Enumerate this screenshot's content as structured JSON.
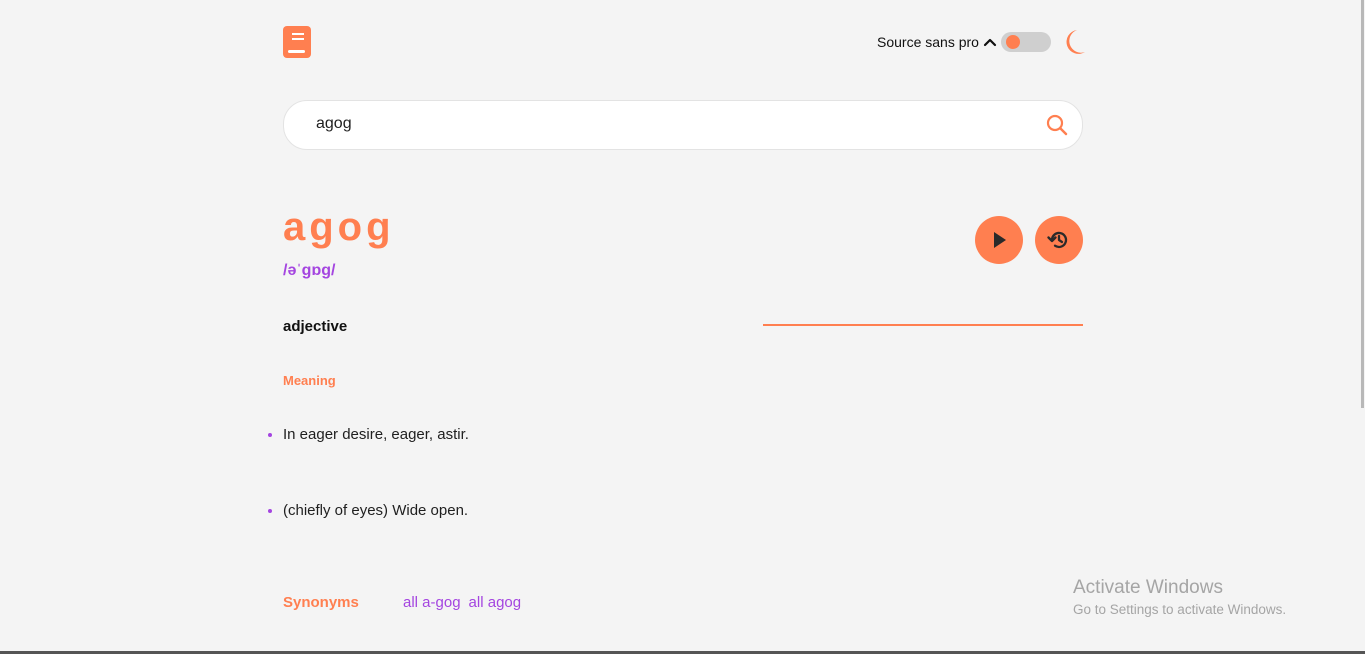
{
  "header": {
    "logo_icon": "book-icon",
    "font_selector": {
      "label": "Source sans pro",
      "icon": "chevron-up-icon"
    },
    "theme_toggle": {
      "state": "off",
      "icon": "moon-icon"
    }
  },
  "search": {
    "value": "agog",
    "placeholder": "",
    "icon": "search-icon"
  },
  "entry": {
    "word": "agog",
    "phonetic": "/əˈɡɒɡ/",
    "actions": {
      "play_icon": "play-icon",
      "history_icon": "history-icon"
    },
    "part_of_speech": "adjective",
    "meaning_heading": "Meaning",
    "definitions": [
      "In eager desire, eager, astir.",
      "(chiefly of eyes) Wide open."
    ],
    "synonyms_heading": "Synonyms",
    "synonyms": [
      "all a-gog",
      "all agog"
    ]
  },
  "watermark": {
    "title": "Activate Windows",
    "subtitle": "Go to Settings to activate Windows."
  },
  "colors": {
    "accent": "#ff7f50",
    "secondary": "#a445e0",
    "background": "#f4f4f4"
  }
}
